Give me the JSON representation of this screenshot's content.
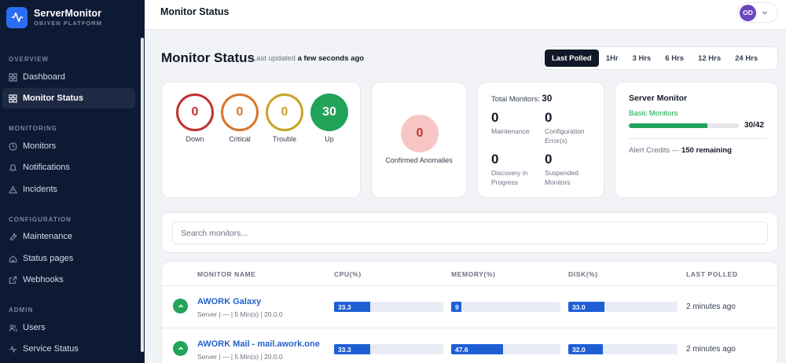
{
  "brand": {
    "name": "ServerMonitor",
    "sub": "OBIYEN PLATFORM"
  },
  "sidebar": {
    "sections": [
      {
        "label": "OVERVIEW"
      },
      {
        "label": "MONITORING"
      },
      {
        "label": "CONFIGURATION"
      },
      {
        "label": "ADMIN"
      }
    ],
    "items": [
      {
        "label": "Dashboard",
        "icon": "grid-icon"
      },
      {
        "label": "Monitor Status",
        "icon": "grid-icon",
        "active": true
      },
      {
        "label": "Monitors",
        "icon": "clock-icon"
      },
      {
        "label": "Notifications",
        "icon": "bell-icon"
      },
      {
        "label": "Incidents",
        "icon": "warning-icon"
      },
      {
        "label": "Maintenance",
        "icon": "wrench-icon"
      },
      {
        "label": "Status pages",
        "icon": "home-icon"
      },
      {
        "label": "Webhooks",
        "icon": "external-link-icon"
      },
      {
        "label": "Users",
        "icon": "users-icon"
      },
      {
        "label": "Service Status",
        "icon": "activity-icon"
      }
    ]
  },
  "topbar": {
    "title": "Monitor Status",
    "avatar_initials": "OD"
  },
  "header": {
    "title": "Monitor Status",
    "last_updated_prefix": "Last updated",
    "last_updated_value": "a few seconds ago",
    "ranges": [
      "Last Polled",
      "1Hr",
      "3 Hrs",
      "6 Hrs",
      "12 Hrs",
      "24 Hrs"
    ],
    "active_range": "Last Polled"
  },
  "status_rings": [
    {
      "value": "0",
      "label": "Down",
      "color": "#c53030"
    },
    {
      "value": "0",
      "label": "Critical",
      "color": "#d9772b"
    },
    {
      "value": "0",
      "label": "Trouble",
      "color": "#c9a227"
    },
    {
      "value": "30",
      "label": "Up",
      "color": "#22a35a"
    }
  ],
  "anomalies": {
    "value": "0",
    "label": "Confirmed Anomalies"
  },
  "totals": {
    "label": "Total Monitors:",
    "value": "30",
    "stats": [
      {
        "value": "0",
        "label": "Maintenance"
      },
      {
        "value": "0",
        "label": "Configuration Error(s)"
      },
      {
        "value": "0",
        "label": "Discovery in Progress"
      },
      {
        "value": "0",
        "label": "Suspended Monitors"
      }
    ]
  },
  "server_monitor": {
    "title": "Server Monitor",
    "subtitle": "Basic Monitors",
    "used": 30,
    "limit": 42,
    "count_text": "30/42",
    "credits_prefix": "Alert Credits —",
    "credits_value": "150 remaining"
  },
  "search": {
    "placeholder": "Search monitors..."
  },
  "table": {
    "columns": [
      "MONITOR NAME",
      "CPU(%)",
      "MEMORY(%)",
      "DISK(%)",
      "LAST POLLED"
    ],
    "rows": [
      {
        "name": "AWORK Galaxy",
        "meta": "Server | — | 5 Min(s) | 20.0.0",
        "cpu": 33.3,
        "cpu_text": "33.3",
        "memory": 9,
        "memory_text": "9",
        "disk": 33.0,
        "disk_text": "33.0",
        "last_polled": "2 minutes ago"
      },
      {
        "name": "AWORK Mail - mail.awork.one",
        "meta": "Server | — | 5 Min(s) | 20.0.0",
        "cpu": 33.3,
        "cpu_text": "33.3",
        "memory": 47.6,
        "memory_text": "47.6",
        "disk": 32.0,
        "disk_text": "32.0",
        "last_polled": "2 minutes ago"
      }
    ]
  },
  "colors": {
    "sidebar_bg": "#0c1a33",
    "accent": "#2563c9",
    "bar": "#1f5fd6",
    "up": "#22a35a"
  }
}
